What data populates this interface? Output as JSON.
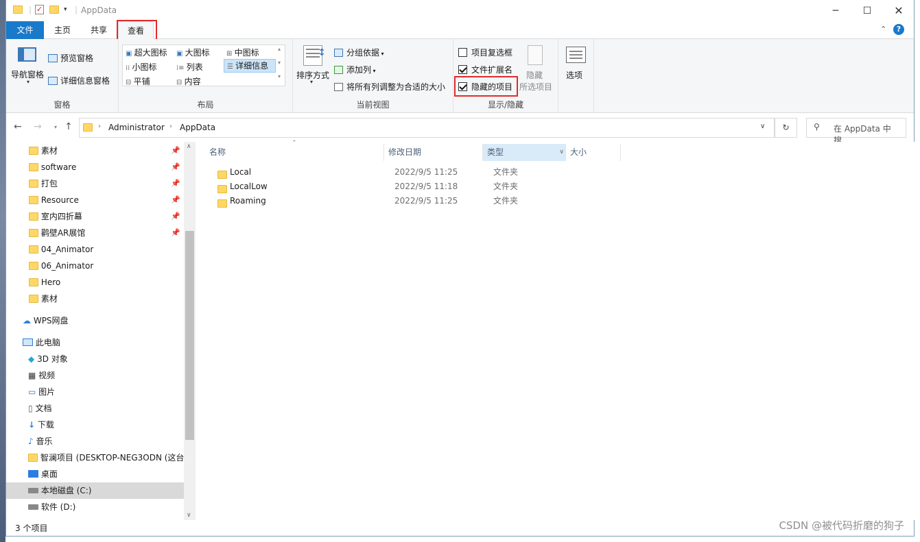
{
  "window": {
    "title": "AppData"
  },
  "ribbon_tabs": [
    "文件",
    "主页",
    "共享",
    "查看"
  ],
  "ribbon": {
    "pane_group": {
      "label": "窗格",
      "nav_pane": "导航窗格",
      "preview_pane": "预览窗格",
      "details_pane": "详细信息窗格"
    },
    "layout_group": {
      "label": "布局",
      "items": [
        "超大图标",
        "大图标",
        "中图标",
        "小图标",
        "列表",
        "详细信息",
        "平铺",
        "内容"
      ],
      "selected": "详细信息"
    },
    "current_view_group": {
      "label": "当前视图",
      "sort": "排序方式",
      "group_by": "分组依据",
      "add_column": "添加列",
      "fit_columns": "将所有列调整为合适的大小"
    },
    "show_hide_group": {
      "label": "显示/隐藏",
      "checkbox_items": {
        "label": "项目复选框",
        "checked": false
      },
      "file_extensions": {
        "label": "文件扩展名",
        "checked": true
      },
      "hidden_items": {
        "label": "隐藏的项目",
        "checked": true
      },
      "hide_selected_1": "隐藏",
      "hide_selected_2": "所选项目"
    },
    "options_group": {
      "options": "选项"
    }
  },
  "address": {
    "crumbs": [
      "Administrator",
      "AppData"
    ],
    "search_placeholder": "在 AppData 中搜..."
  },
  "nav_pane": {
    "quick_access": [
      {
        "label": "素材",
        "pinned": true
      },
      {
        "label": "software",
        "pinned": true
      },
      {
        "label": "打包",
        "pinned": true
      },
      {
        "label": "Resource",
        "pinned": true
      },
      {
        "label": "室内四折幕",
        "pinned": true
      },
      {
        "label": "鹳壁AR展馆",
        "pinned": true
      },
      {
        "label": "04_Animator",
        "pinned": false
      },
      {
        "label": "06_Animator",
        "pinned": false
      },
      {
        "label": "Hero",
        "pinned": false
      },
      {
        "label": "素材",
        "pinned": false
      }
    ],
    "wps": "WPS网盘",
    "this_pc": "此电脑",
    "pc_items": [
      "3D 对象",
      "视频",
      "图片",
      "文档",
      "下载",
      "音乐",
      "智澜项目 (DESKTOP-NEG3ODN (这台",
      "桌面",
      "本地磁盘 (C:)",
      "软件 (D:)"
    ],
    "selected": "本地磁盘 (C:)"
  },
  "columns": {
    "name": "名称",
    "date": "修改日期",
    "type": "类型",
    "size": "大小"
  },
  "files": [
    {
      "name": "Local",
      "date": "2022/9/5 11:25",
      "type": "文件夹"
    },
    {
      "name": "LocalLow",
      "date": "2022/9/5 11:18",
      "type": "文件夹"
    },
    {
      "name": "Roaming",
      "date": "2022/9/5 11:25",
      "type": "文件夹"
    }
  ],
  "status": {
    "count": "3 个项目"
  },
  "watermark": "CSDN @被代码折磨的狗子",
  "colors": {
    "file_tab": "#1979ca",
    "highlight": "#e02b2b",
    "folder": "#ffd768"
  }
}
